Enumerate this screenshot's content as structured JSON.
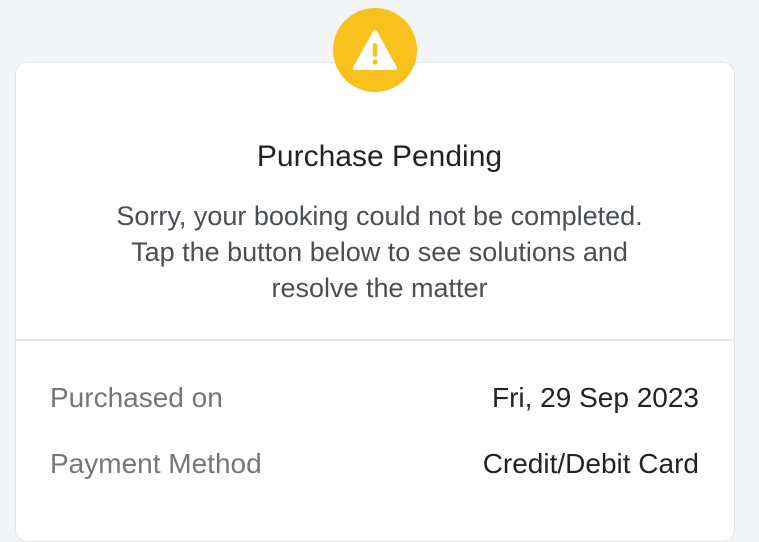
{
  "status": {
    "icon": "warning-icon",
    "title": "Purchase Pending",
    "message_lines": [
      "Sorry, your booking could not be completed.",
      "Tap the button below to see solutions and",
      "resolve the matter"
    ]
  },
  "details": [
    {
      "label": "Purchased on",
      "value": "Fri, 29 Sep 2023"
    },
    {
      "label": "Payment Method",
      "value": "Credit/Debit Card"
    }
  ],
  "colors": {
    "warning": "#f9c11b",
    "background": "#f3f4f6",
    "card": "#ffffff"
  }
}
